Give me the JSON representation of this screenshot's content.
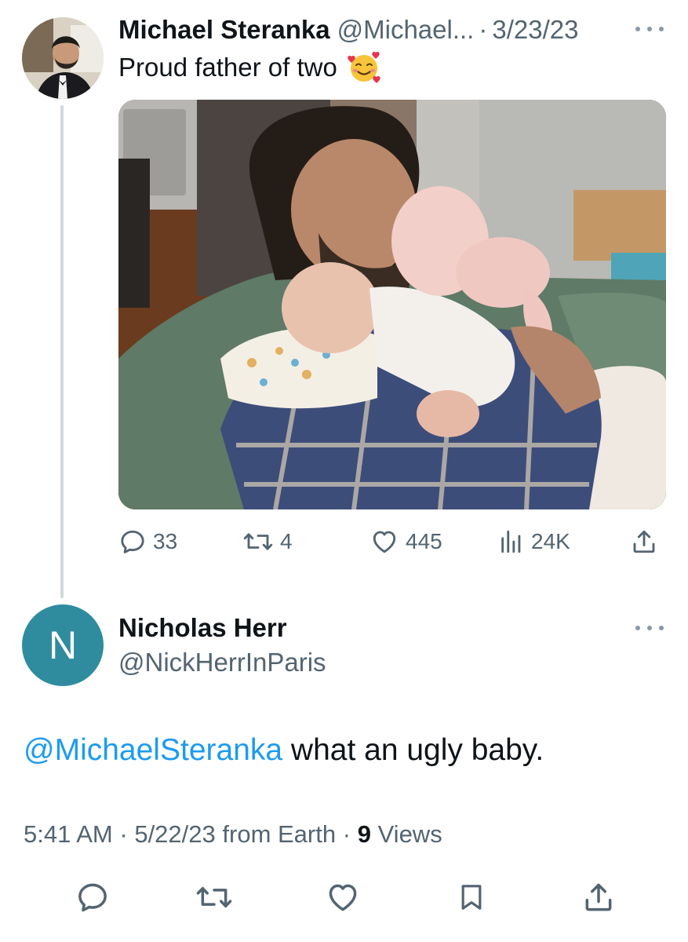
{
  "parent": {
    "author_name": "Michael Steranka",
    "handle": "@Michael...",
    "separator": "·",
    "date": "3/23/23",
    "text": "Proud father of two",
    "emoji_icon": "smiling-face-with-hearts-icon",
    "stats": {
      "replies": "33",
      "retweets": "4",
      "likes": "445",
      "views": "24K"
    }
  },
  "reply": {
    "avatar_letter": "N",
    "author_name": "Nicholas Herr",
    "handle": "@NickHerrInParis",
    "mention": "@MichaelSteranka",
    "text": " what an ugly baby.",
    "meta": {
      "time": "5:41 AM",
      "separator": "·",
      "date": "5/22/23",
      "from": "from Earth",
      "views_count": "9",
      "views_label": "Views"
    }
  },
  "colors": {
    "link": "#1d9bf0",
    "secondary_text": "#536471",
    "avatar_bg": "#2e8c9e",
    "thread_line": "#cfd9de"
  }
}
